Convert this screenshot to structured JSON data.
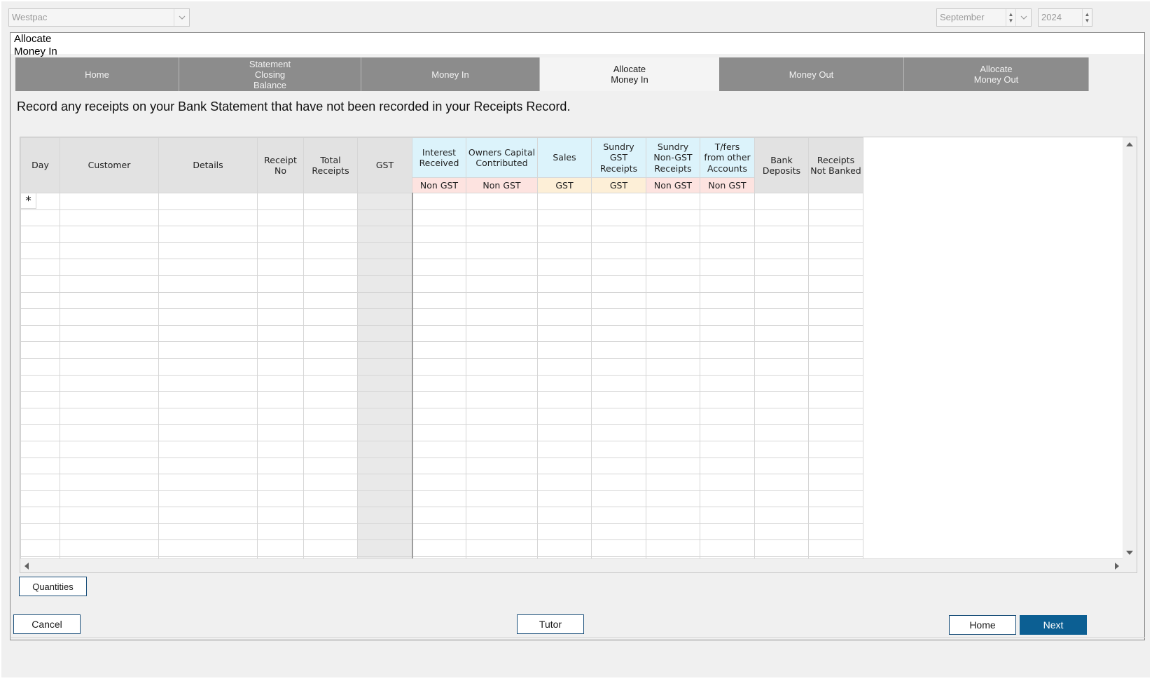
{
  "bank_select": {
    "value": "Westpac",
    "icon": "chevron-down-icon"
  },
  "period": {
    "month": "September",
    "year": "2024"
  },
  "panel": {
    "title": "Allocate\nMoney In"
  },
  "tabs": [
    {
      "label": "Home",
      "active": false
    },
    {
      "label": "Statement\nClosing\nBalance",
      "active": false
    },
    {
      "label": "Money In",
      "active": false
    },
    {
      "label": "Allocate\nMoney In",
      "active": true
    },
    {
      "label": "Money Out",
      "active": false
    },
    {
      "label": "Allocate\nMoney Out",
      "active": false
    }
  ],
  "instruction": "Record any receipts on your Bank Statement that have not been recorded in your Receipts Record.",
  "grid": {
    "columns": [
      {
        "key": "day",
        "label": "Day",
        "tag": ""
      },
      {
        "key": "customer",
        "label": "Customer",
        "tag": ""
      },
      {
        "key": "details",
        "label": "Details",
        "tag": ""
      },
      {
        "key": "receipt_no",
        "label": "Receipt\nNo",
        "tag": ""
      },
      {
        "key": "total_receipts",
        "label": "Total\nReceipts",
        "tag": ""
      },
      {
        "key": "gst",
        "label": "GST",
        "tag": ""
      },
      {
        "key": "interest_received",
        "label": "Interest\nReceived",
        "tag": "Non GST"
      },
      {
        "key": "owners_capital",
        "label": "Owners Capital\nContributed",
        "tag": "Non GST"
      },
      {
        "key": "sales",
        "label": "Sales",
        "tag": "GST"
      },
      {
        "key": "sundry_gst",
        "label": "Sundry\nGST\nReceipts",
        "tag": "GST"
      },
      {
        "key": "sundry_non_gst",
        "label": "Sundry\nNon-GST\nReceipts",
        "tag": "Non GST"
      },
      {
        "key": "transfers",
        "label": "T/fers\nfrom other\nAccounts",
        "tag": "Non GST"
      },
      {
        "key": "bank_deposits",
        "label": "Bank\nDeposits",
        "tag": ""
      },
      {
        "key": "receipts_not_banked",
        "label": "Receipts\nNot Banked",
        "tag": ""
      }
    ],
    "new_row_marker": "*",
    "rows": []
  },
  "buttons": {
    "quantities": "Quantities",
    "cancel": "Cancel",
    "tutor": "Tutor",
    "home": "Home",
    "next": "Next"
  },
  "colors": {
    "tab_bg": "#8c8c8c",
    "header_blue": "#dcf3fb",
    "tag_non_gst": "#fde3e0",
    "tag_gst": "#fdefd7",
    "primary_button": "#0c5f93"
  }
}
